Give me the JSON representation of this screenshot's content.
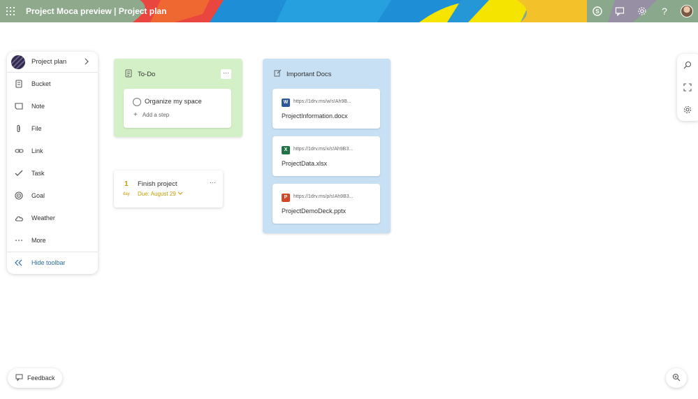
{
  "header": {
    "title": "Project Moca preview | Project plan",
    "icons": [
      "skype-icon",
      "feedback-chat-icon",
      "settings-icon",
      "help-icon",
      "user-avatar"
    ],
    "help_glyph": "?"
  },
  "toolbar": {
    "title": "Project plan",
    "items": [
      {
        "label": "Bucket",
        "icon": "bucket-icon"
      },
      {
        "label": "Note",
        "icon": "note-icon"
      },
      {
        "label": "File",
        "icon": "paperclip-icon"
      },
      {
        "label": "Link",
        "icon": "link-icon"
      },
      {
        "label": "Task",
        "icon": "checkmark-icon"
      },
      {
        "label": "Goal",
        "icon": "target-icon"
      },
      {
        "label": "Weather",
        "icon": "weather-icon"
      },
      {
        "label": "More",
        "icon": "ellipsis-icon"
      }
    ],
    "hide_label": "Hide toolbar"
  },
  "todo": {
    "title": "To-Do",
    "item": "Organize my space",
    "add_step": "Add a step"
  },
  "task": {
    "days": "1",
    "unit": "day",
    "title": "Finish project",
    "due": "Due: August 29"
  },
  "docs": {
    "title": "Important Docs",
    "items": [
      {
        "type": "word",
        "url": "https://1drv.ms/w/s!Ah9B...",
        "name": "ProjectInformation.docx",
        "color": "#2b579a",
        "letter": "W"
      },
      {
        "type": "excel",
        "url": "https://1drv.ms/x/s!Ah9B3...",
        "name": "ProjectData.xlsx",
        "color": "#217346",
        "letter": "X"
      },
      {
        "type": "powerpoint",
        "url": "https://1drv.ms/p/s!Ah9B3...",
        "name": "ProjectDemoDeck.pptx",
        "color": "#d24726",
        "letter": "P"
      }
    ]
  },
  "feedback": {
    "label": "Feedback"
  },
  "colors": {
    "todo_bg": "#d4f0c7",
    "docs_bg": "#c7e0f4",
    "accent_blue": "#2b6cb0",
    "due_gold": "#c19c00"
  }
}
